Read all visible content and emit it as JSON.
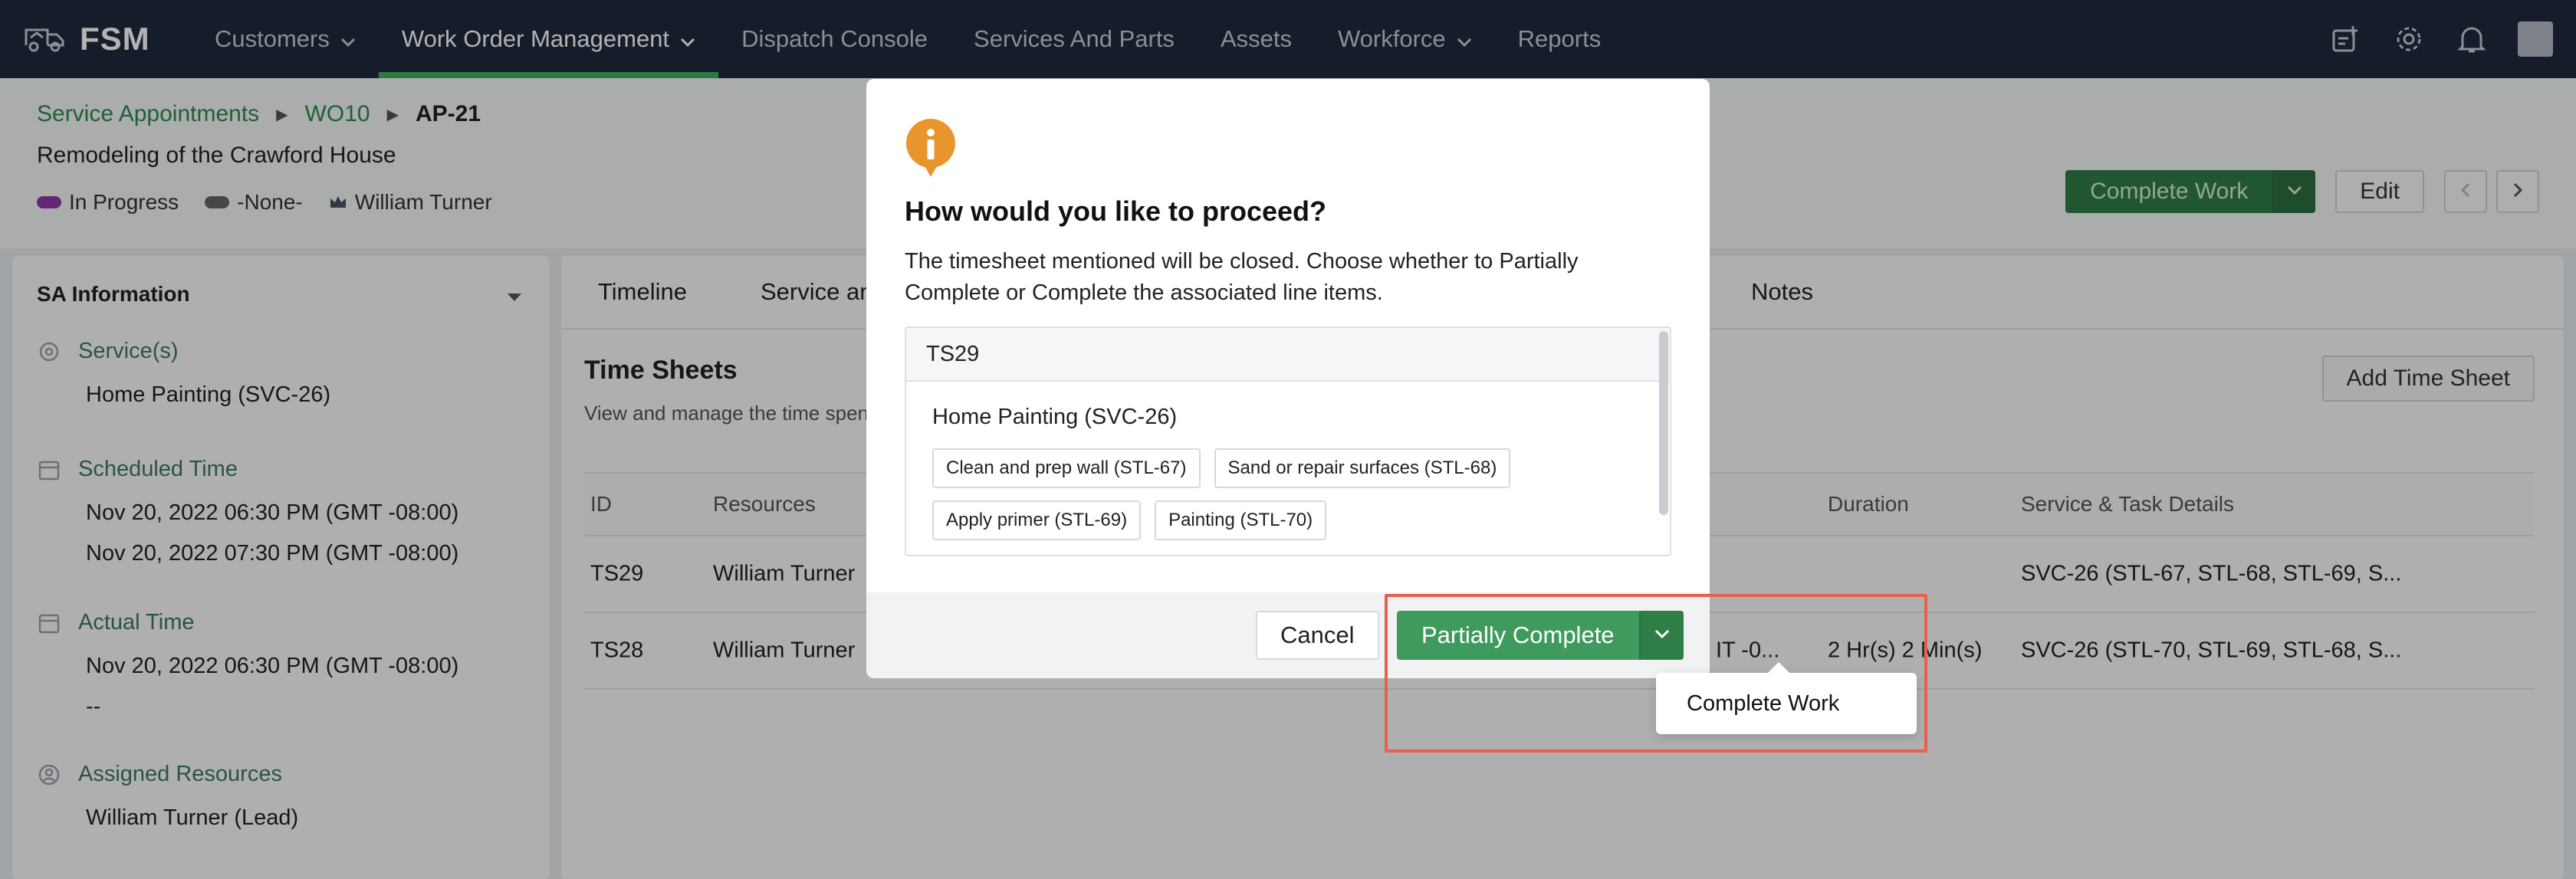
{
  "topnav": {
    "brand": "FSM",
    "items": [
      {
        "label": "Customers",
        "has_dropdown": true
      },
      {
        "label": "Work Order Management",
        "has_dropdown": true,
        "active": true
      },
      {
        "label": "Dispatch Console"
      },
      {
        "label": "Services And Parts"
      },
      {
        "label": "Assets"
      },
      {
        "label": "Workforce",
        "has_dropdown": true
      },
      {
        "label": "Reports"
      }
    ],
    "right_icons": [
      "compose-icon",
      "gear-icon",
      "bell-icon",
      "avatar"
    ]
  },
  "header": {
    "breadcrumb": [
      "Service Appointments",
      "WO10",
      "AP-21"
    ],
    "subtitle": "Remodeling of the Crawford House",
    "tags": [
      {
        "label": "In Progress",
        "color": "#8e3aa6"
      },
      {
        "label": "-None-",
        "color": "#666666"
      },
      {
        "label": "William Turner",
        "icon": "crown-icon"
      }
    ],
    "complete_work_label": "Complete Work",
    "edit_label": "Edit"
  },
  "sa_info": {
    "title": "SA Information",
    "services_label": "Service(s)",
    "services_value": "Home Painting (SVC-26)",
    "scheduled_label": "Scheduled Time",
    "scheduled_start": "Nov 20, 2022 06:30 PM (GMT -08:00)",
    "scheduled_end": "Nov 20, 2022 07:30 PM (GMT -08:00)",
    "actual_label": "Actual Time",
    "actual_start": "Nov 20, 2022 06:30 PM (GMT -08:00)",
    "actual_end": "--",
    "resources_label": "Assigned Resources",
    "resources_value": "William Turner (Lead)"
  },
  "main": {
    "tabs": [
      "Timeline",
      "Service and",
      "Notes"
    ],
    "section_title": "Time Sheets",
    "section_desc": "View and manage the time spent",
    "add_button": "Add Time Sheet",
    "columns": {
      "id": "ID",
      "resources": "Resources",
      "duration": "Duration",
      "details": "Service & Task Details"
    },
    "rows": [
      {
        "id": "TS29",
        "resource": "William Turner",
        "partial": "",
        "duration": "",
        "details": "SVC-26 (STL-67, STL-68, STL-69, S..."
      },
      {
        "id": "TS28",
        "resource": "William Turner",
        "partial": "IT -0...",
        "duration": "2 Hr(s) 2 Min(s)",
        "details": "SVC-26 (STL-70, STL-69, STL-68, S..."
      }
    ]
  },
  "modal": {
    "title": "How would you like to proceed?",
    "text": "The timesheet mentioned will be closed. Choose whether to Partially Complete or Complete the associated line items.",
    "timesheet_id": "TS29",
    "service": "Home Painting (SVC-26)",
    "tasks": [
      "Clean and prep wall (STL-67)",
      "Sand or repair surfaces (STL-68)",
      "Apply primer (STL-69)",
      "Painting (STL-70)"
    ],
    "cancel_label": "Cancel",
    "primary_label": "Partially Complete",
    "dropdown_option": "Complete Work"
  },
  "colors": {
    "nav_bg": "#1f2a3d",
    "accent_green": "#3f9a5d",
    "highlight": "#e8604c",
    "info_icon": "#e8952e"
  }
}
